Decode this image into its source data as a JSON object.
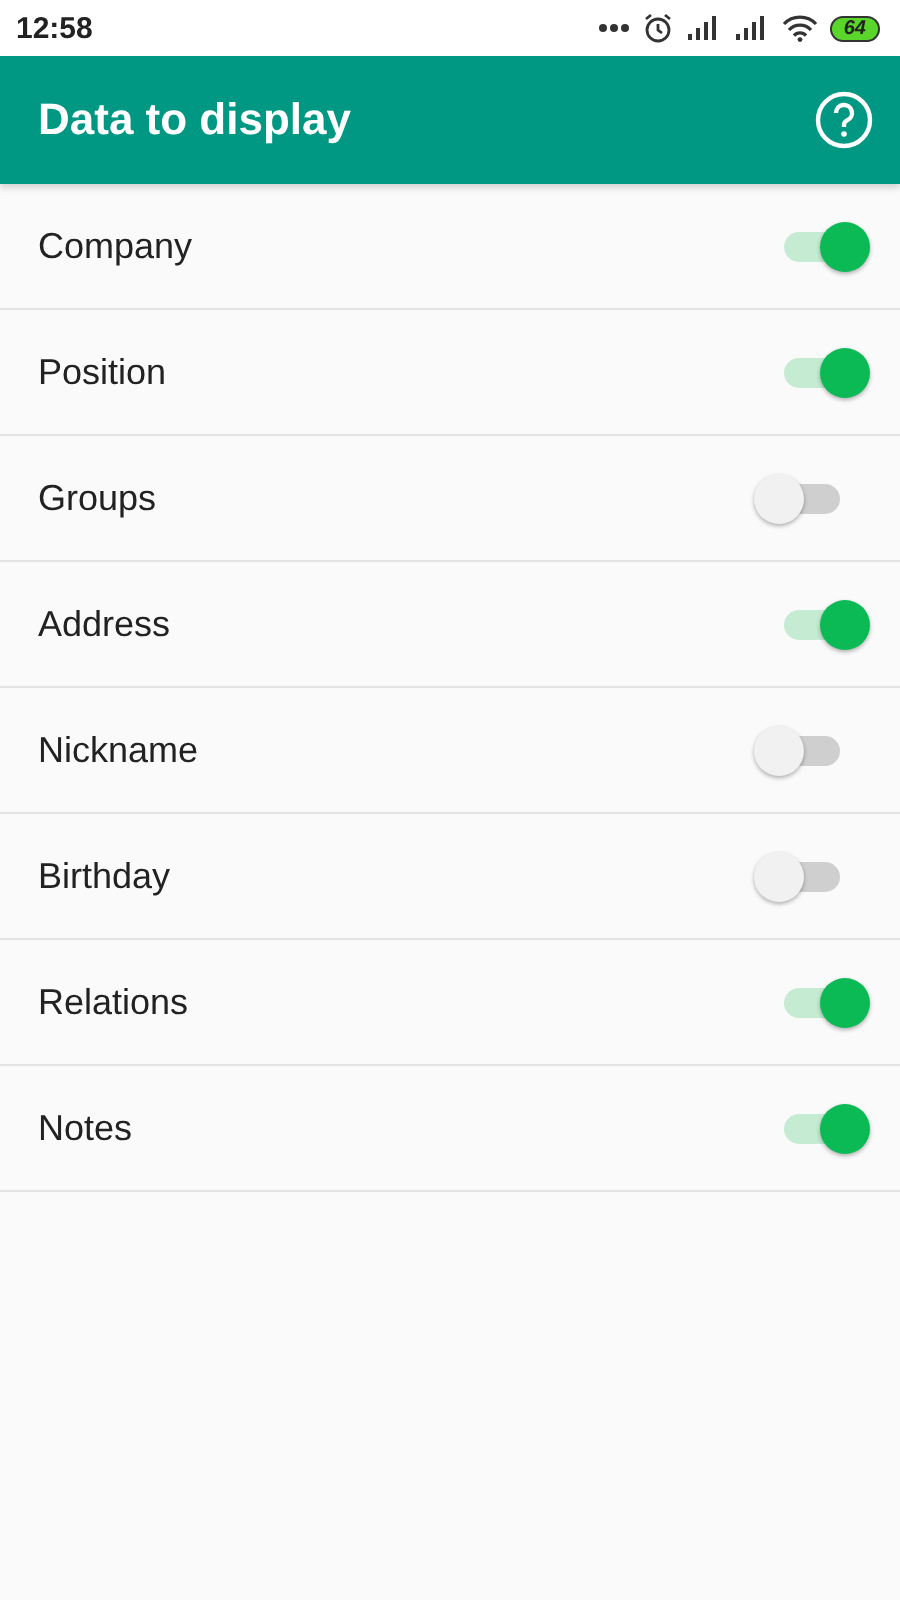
{
  "status_bar": {
    "time": "12:58",
    "battery": "64"
  },
  "app_bar": {
    "title": "Data to display"
  },
  "settings": [
    {
      "label": "Company",
      "on": true
    },
    {
      "label": "Position",
      "on": true
    },
    {
      "label": "Groups",
      "on": false
    },
    {
      "label": "Address",
      "on": true
    },
    {
      "label": "Nickname",
      "on": false
    },
    {
      "label": "Birthday",
      "on": false
    },
    {
      "label": "Relations",
      "on": true
    },
    {
      "label": "Notes",
      "on": true
    }
  ]
}
